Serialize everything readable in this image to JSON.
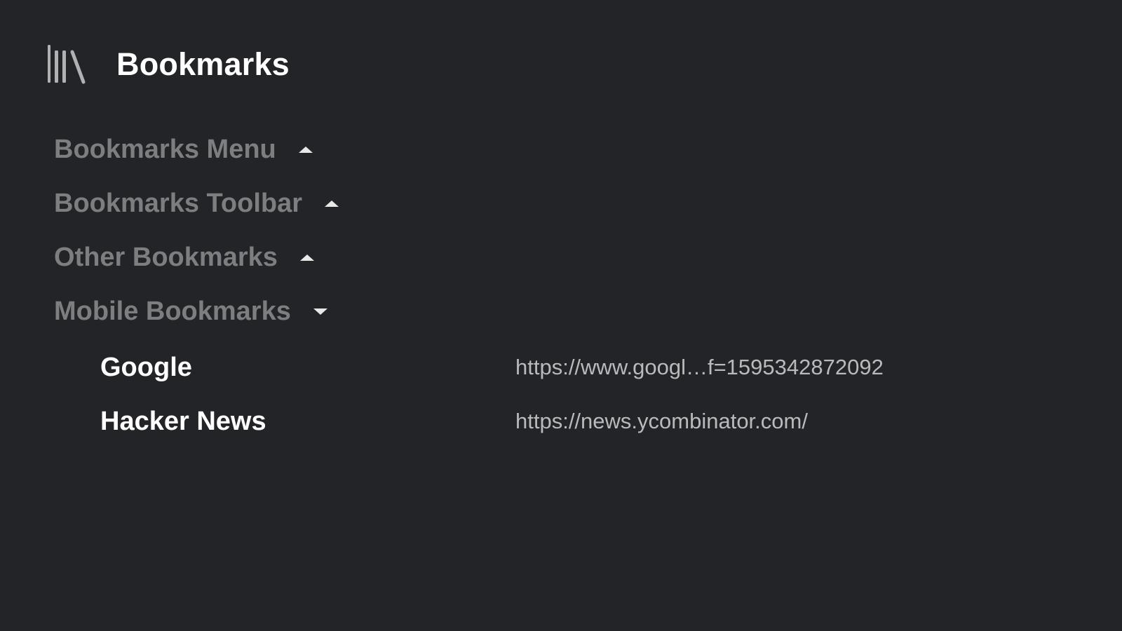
{
  "header": {
    "title": "Bookmarks",
    "icon": "library-icon"
  },
  "folders": [
    {
      "label": "Bookmarks Menu",
      "state": "collapsed",
      "arrow_icon": "triangle-up-icon"
    },
    {
      "label": "Bookmarks Toolbar",
      "state": "collapsed",
      "arrow_icon": "triangle-up-icon"
    },
    {
      "label": "Other Bookmarks",
      "state": "collapsed",
      "arrow_icon": "triangle-up-icon"
    },
    {
      "label": "Mobile Bookmarks",
      "state": "expanded",
      "arrow_icon": "triangle-down-icon"
    }
  ],
  "mobile_bookmarks": [
    {
      "title": "Google",
      "url": "https://www.googl…f=1595342872092"
    },
    {
      "title": "Hacker News",
      "url": "https://news.ycombinator.com/"
    }
  ],
  "colors": {
    "background": "#232427",
    "title_text": "#ffffff",
    "folder_text": "#7d7e80",
    "url_text": "#b9babc",
    "icon": "#b0b1b3"
  }
}
